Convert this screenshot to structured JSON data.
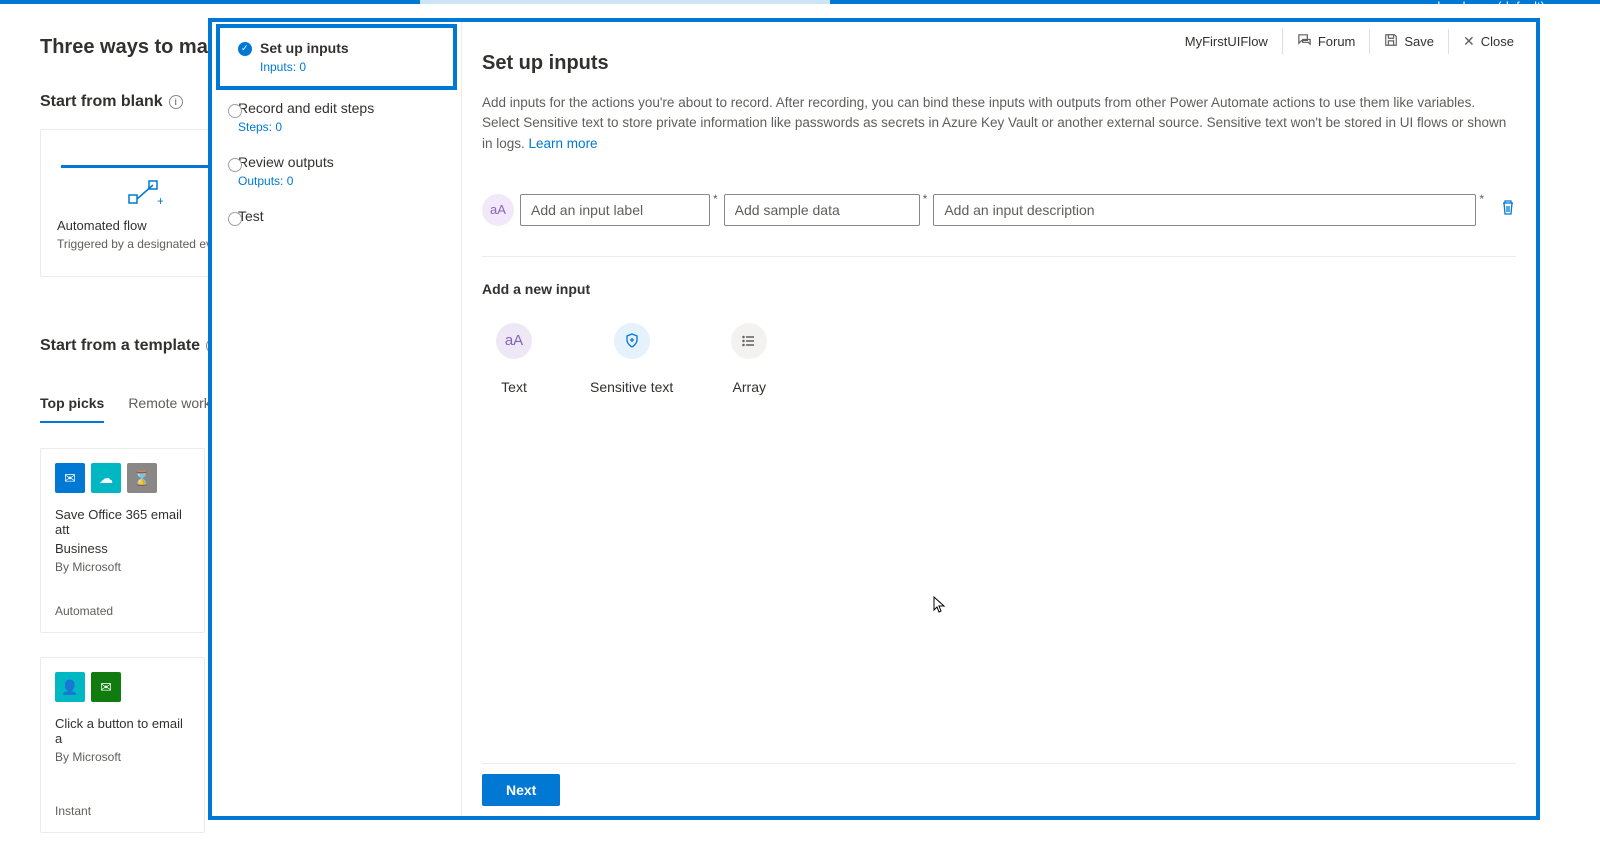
{
  "account": "cbayd.com (default)",
  "background": {
    "title": "Three ways to make a f",
    "start_blank": "Start from blank",
    "card": {
      "title": "Automated flow",
      "subtitle": "Triggered by a designated ev"
    },
    "start_template": "Start from a template",
    "tabs": [
      "Top picks",
      "Remote work"
    ],
    "templates": [
      {
        "name_l1": "Save Office 365 email att",
        "name_l2": "Business",
        "by": "By Microsoft",
        "type": "Automated",
        "icons": [
          "blue",
          "teal",
          "gray"
        ]
      },
      {
        "name_l1": "Click a button to email a",
        "name_l2": "",
        "by": "By Microsoft",
        "type": "Instant",
        "icons": [
          "teal",
          "green"
        ]
      }
    ]
  },
  "header": {
    "flow_name": "MyFirstUIFlow",
    "forum": "Forum",
    "save": "Save",
    "close": "Close"
  },
  "wizard": {
    "steps": [
      {
        "title": "Set up inputs",
        "sub": "Inputs: 0",
        "active": true
      },
      {
        "title": "Record and edit steps",
        "sub": "Steps: 0"
      },
      {
        "title": "Review outputs",
        "sub": "Outputs: 0"
      },
      {
        "title": "Test",
        "sub": ""
      }
    ]
  },
  "main": {
    "heading": "Set up inputs",
    "desc": "Add inputs for the actions you're about to record. After recording, you can bind these inputs with outputs from other Power Automate actions to use them like variables. Select Sensitive text to store private information like passwords as secrets in Azure Key Vault or another external source. Sensitive text won't be stored in UI flows or shown in logs. ",
    "learn_more": "Learn more",
    "placeholders": {
      "label": "Add an input label",
      "sample": "Add sample data",
      "desc": "Add an input description"
    },
    "add_h": "Add a new input",
    "types": [
      "Text",
      "Sensitive text",
      "Array"
    ],
    "next": "Next"
  }
}
